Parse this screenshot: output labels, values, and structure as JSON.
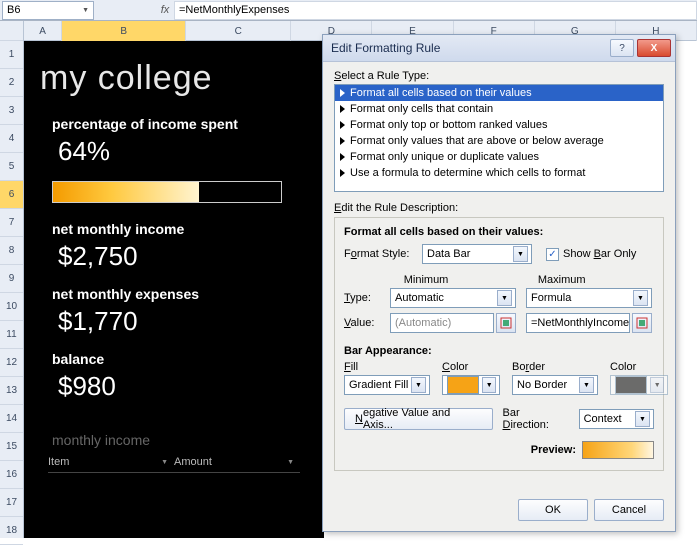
{
  "formula_bar": {
    "cell_ref": "B6",
    "formula": "=NetMonthlyExpenses",
    "fx": "fx"
  },
  "columns": [
    "A",
    "B",
    "C",
    "D",
    "E",
    "F",
    "G",
    "H"
  ],
  "rows": [
    "1",
    "2",
    "3",
    "4",
    "5",
    "6",
    "7",
    "8",
    "9",
    "10",
    "11",
    "12",
    "13",
    "14",
    "15",
    "16",
    "17",
    "18"
  ],
  "selected_row": "6",
  "budget": {
    "title": "my college",
    "pct_label": "percentage of income spent",
    "pct_value": "64%",
    "nmi_label": "net monthly income",
    "nmi_value": "$2,750",
    "nme_label": "net monthly expenses",
    "nme_value": "$1,770",
    "bal_label": "balance",
    "bal_value": "$980",
    "mi_label": "monthly income",
    "table_headers": [
      "Item",
      "Amount"
    ]
  },
  "dialog": {
    "title": "Edit Formatting Rule",
    "help_tip": "?",
    "close_tip": "X",
    "select_rule_label": "Select a Rule Type:",
    "rule_types": [
      "Format all cells based on their values",
      "Format only cells that contain",
      "Format only top or bottom ranked values",
      "Format only values that are above or below average",
      "Format only unique or duplicate values",
      "Use a formula to determine which cells to format"
    ],
    "selected_rule_index": 0,
    "edit_desc_label": "Edit the Rule Description:",
    "format_heading": "Format all cells based on their values:",
    "format_style_label": "Format Style:",
    "format_style_value": "Data Bar",
    "show_bar_only_label": "Show Bar Only",
    "show_bar_only_checked": true,
    "minimum_label": "Minimum",
    "maximum_label": "Maximum",
    "type_label": "Type:",
    "value_label": "Value:",
    "min_type": "Automatic",
    "max_type": "Formula",
    "min_value": "(Automatic)",
    "max_value": "=NetMonthlyIncome",
    "bar_appearance_label": "Bar Appearance:",
    "fill_label": "Fill",
    "color_label": "Color",
    "border_label": "Border",
    "fill_value": "Gradient Fill",
    "border_value": "No Border",
    "neg_axis_label": "Negative Value and Axis...",
    "bar_direction_label": "Bar Direction:",
    "bar_direction_value": "Context",
    "preview_label": "Preview:",
    "ok_label": "OK",
    "cancel_label": "Cancel"
  },
  "chart_data": {
    "type": "bar",
    "categories": [
      "percentage of income spent"
    ],
    "values": [
      64
    ],
    "ylim": [
      0,
      100
    ],
    "xlabel": "",
    "ylabel": "",
    "title": ""
  }
}
